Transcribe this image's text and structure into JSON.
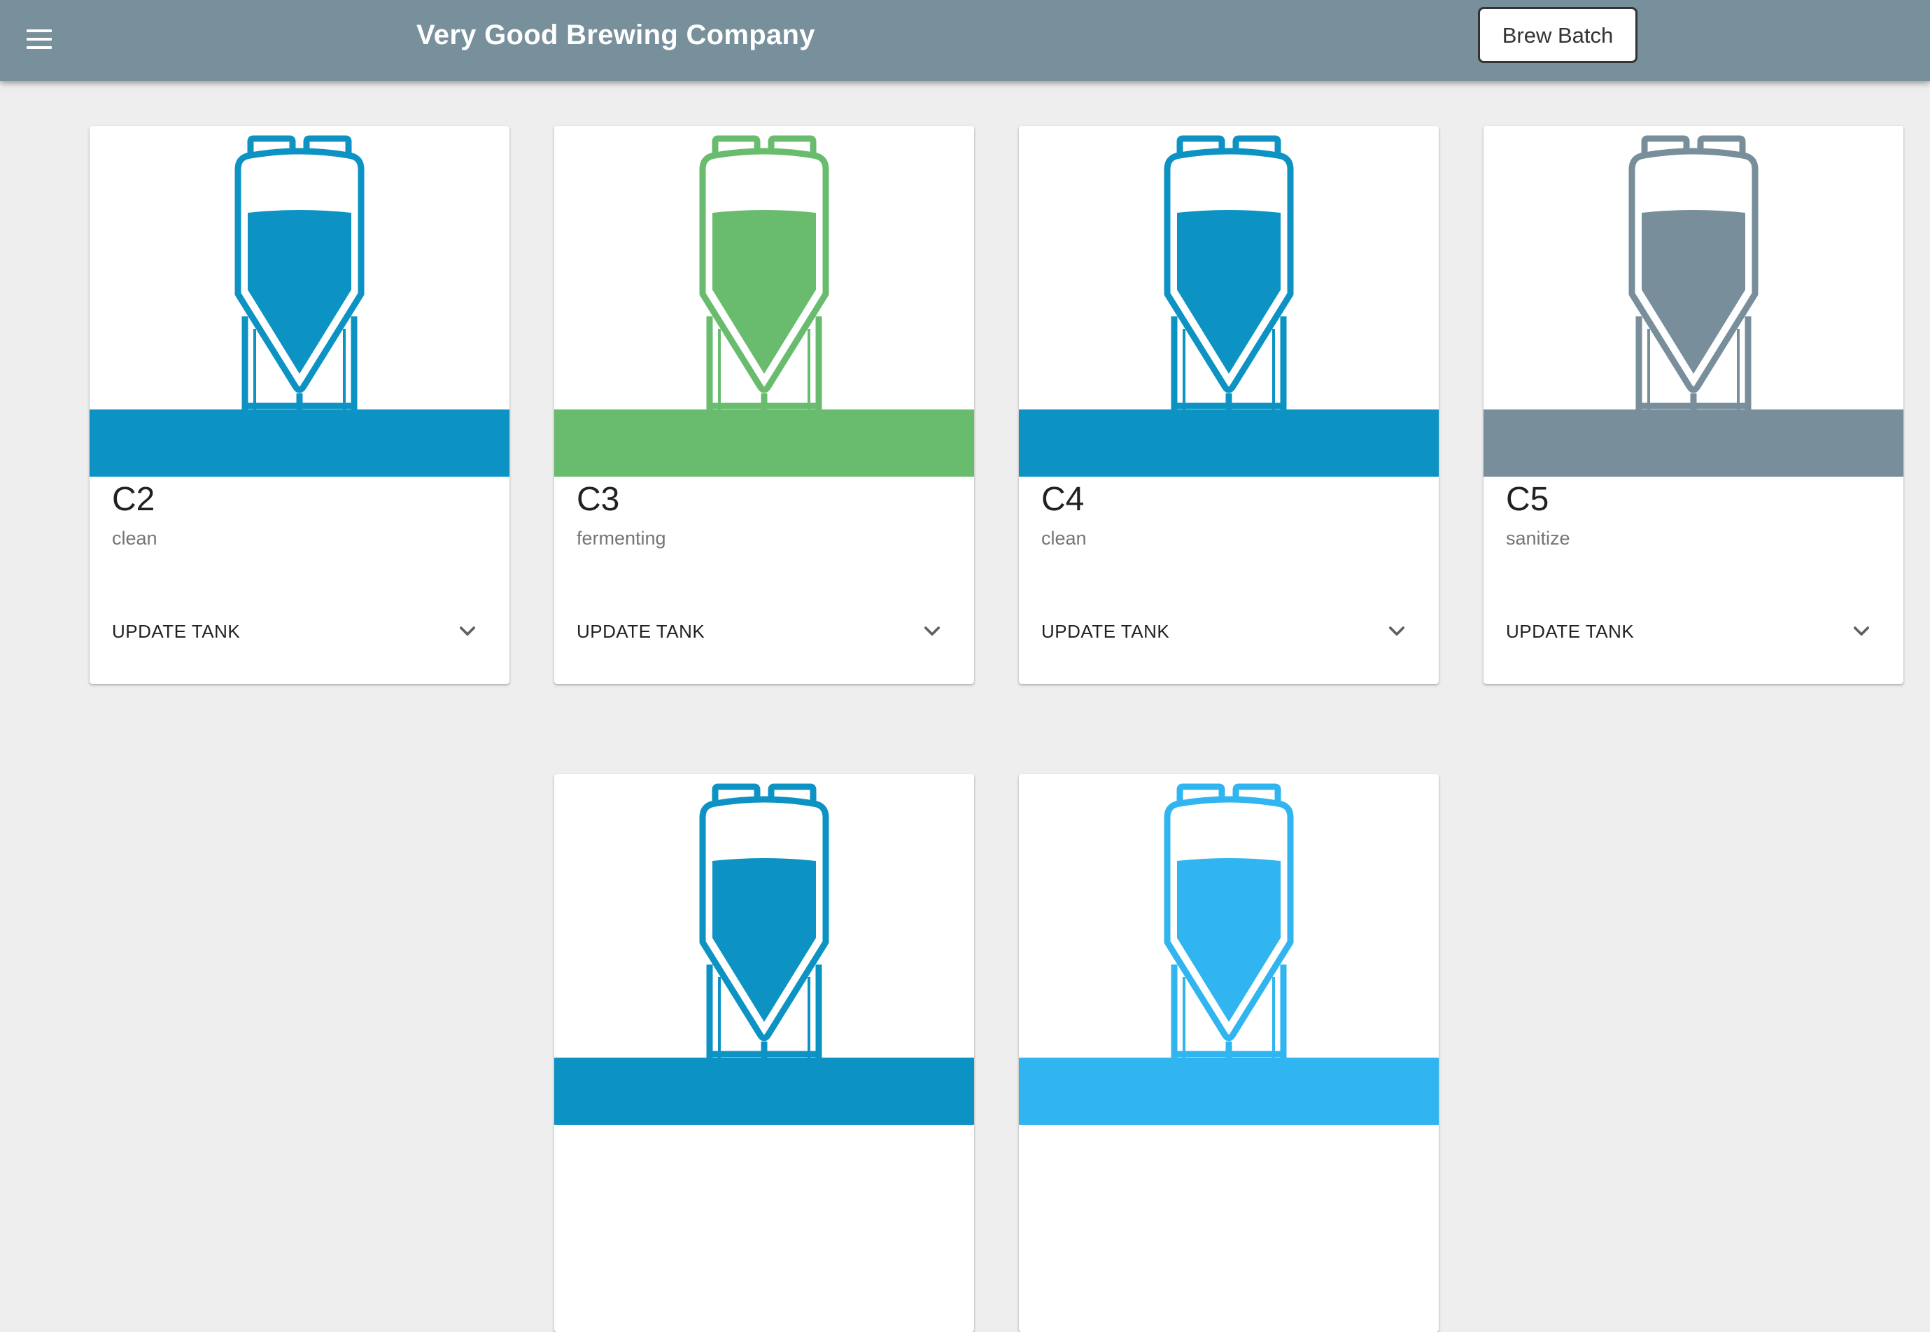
{
  "appbar": {
    "title": "Very Good Brewing Company",
    "brew_batch_label": "Brew Batch",
    "menu_icon": "menu-icon"
  },
  "tanks": [
    {
      "name": "C2",
      "status": "clean",
      "action_label": "UPDATE TANK",
      "color": "#0c93c4"
    },
    {
      "name": "C3",
      "status": "fermenting",
      "action_label": "UPDATE TANK",
      "color": "#69bc6e"
    },
    {
      "name": "C4",
      "status": "clean",
      "action_label": "UPDATE TANK",
      "color": "#0c93c4"
    },
    {
      "name": "C5",
      "status": "sanitize",
      "action_label": "UPDATE TANK",
      "color": "#788f9b"
    },
    {
      "color": "#0c93c4"
    },
    {
      "color": "#30b5f0"
    }
  ],
  "icons": {
    "tank": "fermenter-tank-icon",
    "expand": "chevron-down-icon"
  }
}
